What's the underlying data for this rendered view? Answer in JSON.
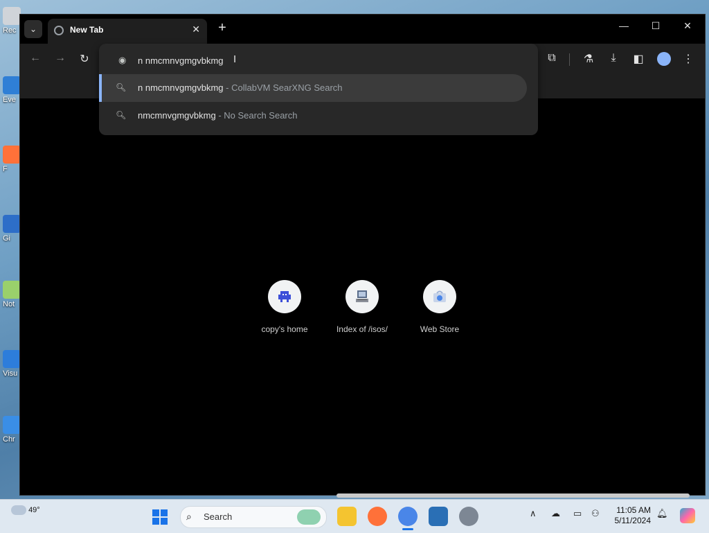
{
  "desktop": {
    "icons": [
      {
        "label": "Rec",
        "color": "#d0d4d9"
      },
      {
        "label": "Eve",
        "color": "#2f7fd6"
      },
      {
        "label": "F",
        "color": "#ff7139"
      },
      {
        "label": "Gi",
        "color": "#2d6ec8"
      },
      {
        "label": "Not",
        "color": "#9ad06b"
      },
      {
        "label": "Visu",
        "color": "#2d7ddb"
      },
      {
        "label": "Chr",
        "color": "#3a8ee6"
      }
    ]
  },
  "browser": {
    "tab": {
      "title": "New Tab",
      "close_glyph": "✕"
    },
    "tab_search_glyph": "⌄",
    "new_tab_glyph": "+",
    "window_controls": {
      "minimize": "—",
      "maximize": "☐",
      "close": "✕"
    },
    "toolbar": {
      "back_glyph": "←",
      "forward_glyph": "→",
      "reload_glyph": "↻",
      "extensions_glyph": "⧉",
      "labs_glyph": "⚗",
      "download_glyph": "⤓",
      "sidepanel_glyph": "◧",
      "menu_glyph": "⋮"
    },
    "omnibox": {
      "input_value": "n nmcmnvgmgvbkmg",
      "cursor_glyph": "I",
      "suggestions": [
        {
          "query": "n nmcmnvgmgvbkmg",
          "separator": " - ",
          "engine": "CollabVM SearXNG Search",
          "selected": true
        },
        {
          "query": "nmcmnvgmgvbkmg",
          "separator": " - ",
          "engine": "No Search Search",
          "selected": false
        }
      ]
    },
    "shortcuts": [
      {
        "label": "copy's home",
        "icon": "pixel-invader-icon"
      },
      {
        "label": "Index of /isos/",
        "icon": "computer-icon"
      },
      {
        "label": "Web Store",
        "icon": "web-store-icon"
      }
    ]
  },
  "taskbar": {
    "weather_temp": "49°",
    "search_placeholder": "Search",
    "search_glyph": "⌕",
    "tray": {
      "chevron": "∧",
      "clock_time": "11:05 AM",
      "clock_date": "5/11/2024"
    }
  },
  "colors": {
    "accent": "#8ab4f8",
    "omnibox_bg": "#282828",
    "toolbar_bg": "#1f1f1f"
  }
}
